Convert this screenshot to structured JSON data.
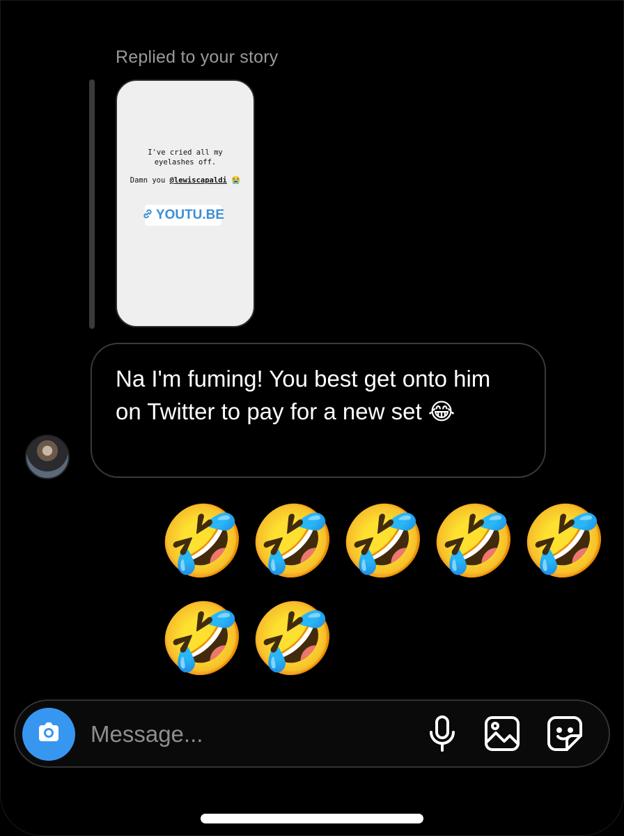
{
  "thread": {
    "reply_label": "Replied to your story",
    "story": {
      "line1": "I've cried all my",
      "line2": "eyelashes off.",
      "line3_prefix": "Damn you ",
      "mention": "@lewiscapaldi",
      "line3_emoji": "😭",
      "link_label": "YOUTU.BE"
    },
    "message": "Na I'm fuming! You best get onto him on Twitter to pay for a new set 😂",
    "emoji_reply": [
      "🤣",
      "🤣",
      "🤣",
      "🤣",
      "🤣",
      "🤣",
      "🤣"
    ]
  },
  "composer": {
    "placeholder": "Message..."
  },
  "colors": {
    "accent": "#3797f0",
    "background": "#000000",
    "bubble_border": "#3a3a3a",
    "secondary_text": "#9a9a9a",
    "link": "#3b8fd6"
  },
  "icons": {
    "camera": "camera-icon",
    "mic": "microphone-icon",
    "gallery": "gallery-icon",
    "sticker": "sticker-icon",
    "link": "link-icon"
  }
}
